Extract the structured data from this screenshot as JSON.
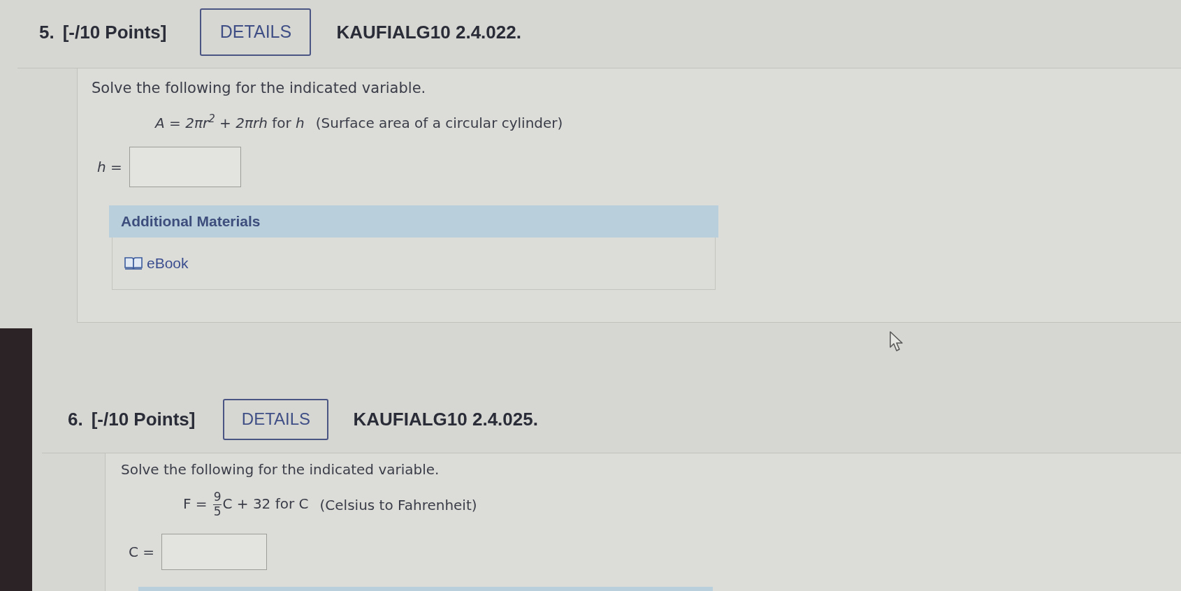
{
  "questions": [
    {
      "number": "5.",
      "points": "[-/10 Points]",
      "details_button": "DETAILS",
      "code": "KAUFIALG10 2.4.022.",
      "prompt": "Solve the following for the indicated variable.",
      "equation": [
        {
          "kind": "math",
          "text": "A = 2πr$^{2}$ + 2πrh"
        },
        {
          "kind": "text",
          "text": "for *h*"
        }
      ],
      "equation_note": "(Surface area of a circular cylinder)",
      "answer_label": "*h* =",
      "additional_materials": {
        "title": "Additional Materials",
        "links": [
          {
            "label": "eBook"
          }
        ]
      }
    },
    {
      "number": "6.",
      "points": "[-/10 Points]",
      "details_button": "DETAILS",
      "code": "KAUFIALG10 2.4.025.",
      "prompt": "Solve the following for the indicated variable.",
      "equation": [
        {
          "kind": "text",
          "text": "F ="
        },
        {
          "kind": "fraction",
          "numerator": "9",
          "denominator": "5"
        },
        {
          "kind": "text",
          "text": "C + 32 for C"
        }
      ],
      "equation_note": "(Celsius to Fahrenheit)",
      "answer_label": "C ="
    }
  ]
}
